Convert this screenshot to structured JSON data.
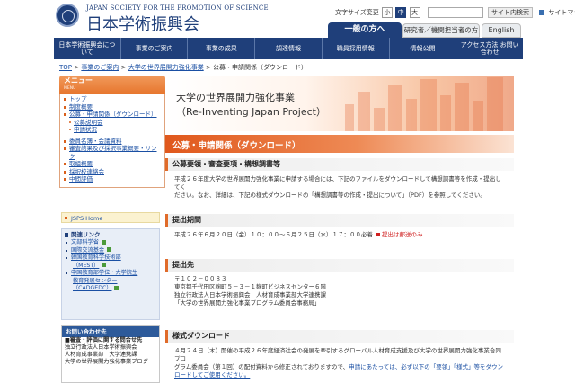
{
  "header": {
    "org_en": "JAPAN SOCIETY FOR THE PROMOTION OF SCIENCE",
    "org_jp": "日本学術振興会",
    "font_size_label": "文字サイズ変更",
    "font_sizes": [
      "小",
      "中",
      "大"
    ],
    "search_label": "サイト内検索",
    "sitemap_label": "サイトマップ"
  },
  "audience_tabs": {
    "general": "一般の方へ",
    "researcher": "研究者／機関担当者の方へ",
    "english": "English"
  },
  "nav": [
    "日本学術振興会について",
    "事業のご案内",
    "事業の成果",
    "調達情報",
    "職員採用情報",
    "情報公開",
    "アクセス方法 お問い合わせ"
  ],
  "breadcrumb": {
    "items": [
      "TOP",
      "事業のご案内",
      "大学の世界展開力強化事業"
    ],
    "current": "公募・申請関係（ダウンロード）",
    "separator": ">"
  },
  "sidebar": {
    "menu_title": "メニュー",
    "menu_subtitle": "MENU",
    "items": [
      {
        "label": "トップ",
        "level": 1
      },
      {
        "label": "制度概要",
        "level": 1
      },
      {
        "label": "公募・申請関係（ダウンロード）",
        "level": 1
      },
      {
        "label": "公募説明会",
        "level": 2
      },
      {
        "label": "申請状況",
        "level": 2
      },
      {
        "label": "委員名簿・会議資料",
        "level": 1
      },
      {
        "label": "審査結果及び採択事業概要・リンク",
        "level": 1
      },
      {
        "label": "取組概要",
        "level": 1
      },
      {
        "label": "採択校連絡会",
        "level": 1
      },
      {
        "label": "中間評価",
        "level": 1
      }
    ],
    "jsps_home": "JSPS Home",
    "related_title": "関連リンク",
    "related_links": [
      {
        "label": "文部科学省"
      },
      {
        "label": "国際交流基金"
      },
      {
        "label": "韓国教育科学技術部",
        "cont": "（MEST）"
      },
      {
        "label": "中国教育部学位・大学院生",
        "cont": "教育発展センター",
        "cont2": "（CADGEDC）"
      }
    ],
    "contact_title": "お問い合わせ先",
    "contact_lines": [
      "■審査・評価に関する問合せ先",
      "独立行政法人日本学術振興会",
      "人材育成事業部　大学連携課",
      "大学の世界展開力強化事業プログ"
    ]
  },
  "banner": {
    "title": "大学の世界展開力強化事業",
    "subtitle": "（Re-Inventing Japan Project）"
  },
  "section_title": "公募・申請関係（ダウンロード）",
  "sections": {
    "guidelines": {
      "heading": "公募要領・審査要項・構想調書等",
      "text1": "平成２６年度大学の世界展開力強化事業に申請する場合には、下記のファイルをダウンロードして構想調書等を作成・提出してく",
      "text2": "ださい。なお、詳細は、下記の様式ダウンロードの「構想調書等の作成・提出について」（PDF）を参照してください。"
    },
    "period": {
      "heading": "提出期間",
      "text": "平成２６年６月２０日（金）１０：００～６月２５日（水）１７：００必着",
      "note": "提出は郵送のみ"
    },
    "address": {
      "heading": "提出先",
      "lines": [
        "〒１０２－００８３",
        "東京都千代田区麹町５－３－１麹町ビジネスセンター６階",
        "独立行政法人日本学術振興会　人材育成事業部大学連携課",
        "「大学の世界展開力強化事業プログラム委員会事務局」"
      ]
    },
    "forms": {
      "heading": "様式ダウンロード",
      "line1": "４月２４日（木）開催の平成２６年度経済社会の発展を牽引するグローバル人材育成支援及び大学の世界展開力強化事業合同プロ",
      "line2_plain": "グラム委員会（第１回）の配付資料から修正されておりますので、",
      "line2_link": "申請にあたっては、必ず以下の「要領」「様式」等をダウン",
      "line3_link": "ロードしてご使用ください。"
    }
  },
  "colors": {
    "brand_navy": "#1f3f7a",
    "accent_orange": "#e0581c",
    "link_blue": "#1a4fa3",
    "alert_red": "#d02020"
  }
}
